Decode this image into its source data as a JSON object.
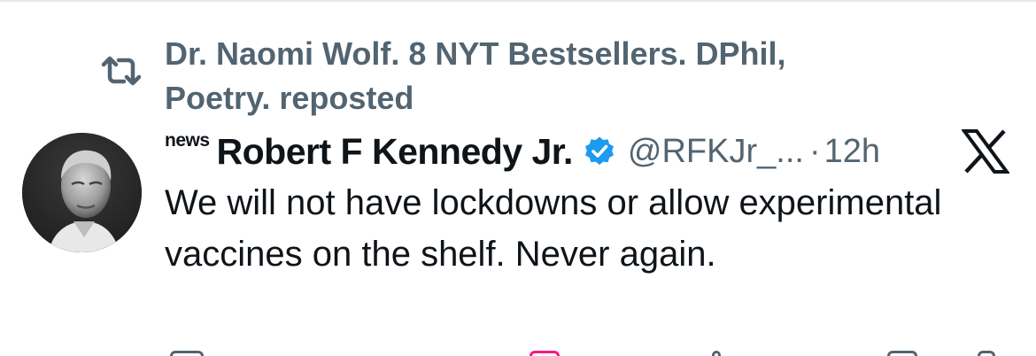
{
  "repost": {
    "text": "Dr. Naomi Wolf. 8 NYT Bestsellers. DPhil, Poetry. reposted",
    "icon": "repost-icon"
  },
  "tweet": {
    "badge": "news",
    "display_name": "Robert F Kennedy Jr.",
    "verified_icon": "verified-badge-icon",
    "handle": "@RFKJr_...",
    "separator": "·",
    "timestamp": "12h",
    "brand_icon": "x-logo-icon",
    "text": "We will not have lockdowns or allow experimental vaccines on the shelf. Never again."
  },
  "colors": {
    "primary_text": "#0f1419",
    "secondary_text": "#536471",
    "verified_blue": "#1d9bf0",
    "like_red": "#f91880"
  }
}
